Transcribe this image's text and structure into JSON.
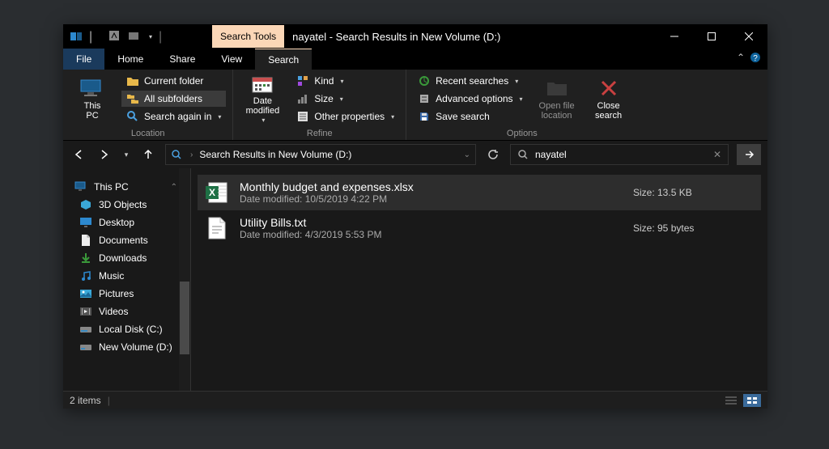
{
  "titlebar": {
    "context_tab": "Search Tools",
    "title": "nayatel - Search Results in New Volume (D:)"
  },
  "menu": {
    "file": "File",
    "home": "Home",
    "share": "Share",
    "view": "View",
    "search": "Search"
  },
  "ribbon": {
    "location": {
      "this_pc": "This\nPC",
      "current_folder": "Current folder",
      "all_subfolders": "All subfolders",
      "search_again_in": "Search again in",
      "label": "Location"
    },
    "refine": {
      "date_modified": "Date\nmodified",
      "kind": "Kind",
      "size": "Size",
      "other_properties": "Other properties",
      "label": "Refine"
    },
    "options": {
      "recent_searches": "Recent searches",
      "advanced_options": "Advanced options",
      "save_search": "Save search",
      "open_file_location": "Open file\nlocation",
      "close_search": "Close\nsearch",
      "label": "Options"
    }
  },
  "address": {
    "path": "Search Results in New Volume (D:)"
  },
  "search": {
    "query": "nayatel"
  },
  "sidebar": {
    "root": "This PC",
    "items": [
      {
        "label": "3D Objects"
      },
      {
        "label": "Desktop"
      },
      {
        "label": "Documents"
      },
      {
        "label": "Downloads"
      },
      {
        "label": "Music"
      },
      {
        "label": "Pictures"
      },
      {
        "label": "Videos"
      },
      {
        "label": "Local Disk (C:)"
      },
      {
        "label": "New Volume (D:)"
      }
    ]
  },
  "results": [
    {
      "name": "Monthly budget and expenses.xlsx",
      "modified_label": "Date modified: 10/5/2019 4:22 PM",
      "size_label": "Size: 13.5 KB",
      "type": "xlsx"
    },
    {
      "name": "Utility Bills.txt",
      "modified_label": "Date modified: 4/3/2019 5:53 PM",
      "size_label": "Size: 95 bytes",
      "type": "txt"
    }
  ],
  "statusbar": {
    "count": "2 items"
  }
}
